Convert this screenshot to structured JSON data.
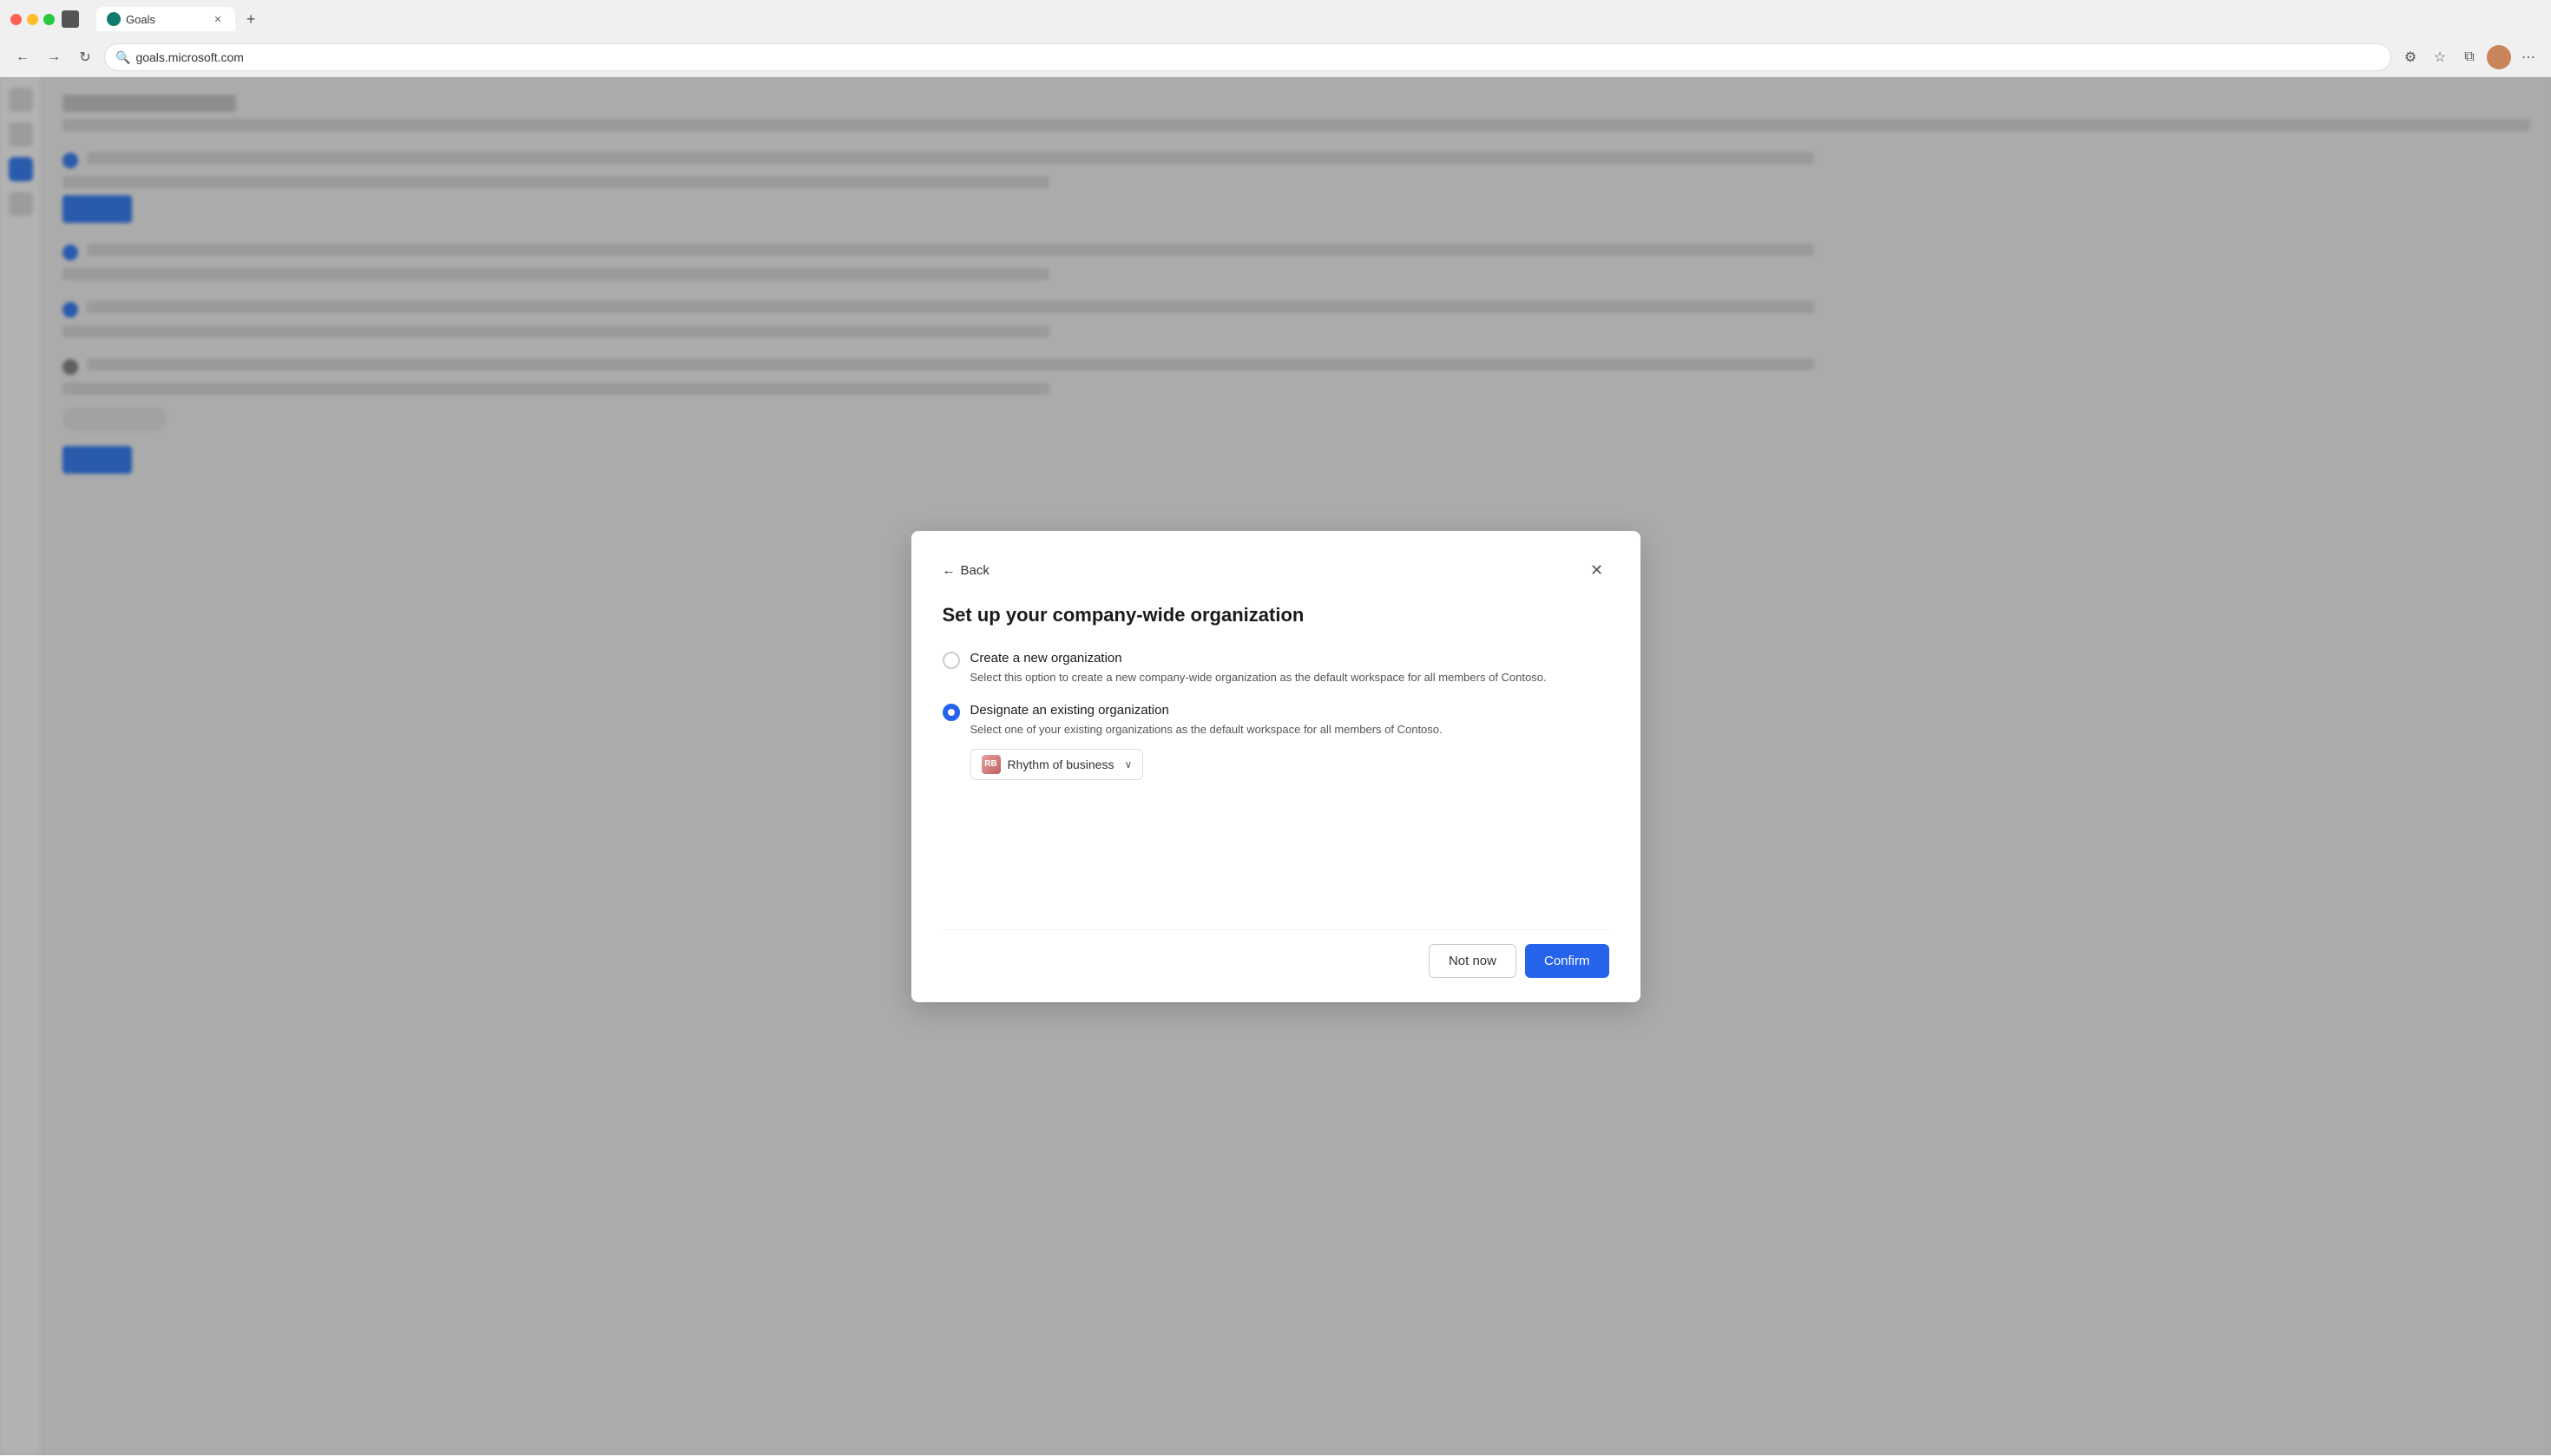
{
  "browser": {
    "tab_title": "Goals",
    "tab_favicon_alt": "Goals favicon",
    "address": "goals.microsoft.com",
    "close_icon": "✕",
    "new_tab_icon": "+",
    "back_icon": "←",
    "forward_icon": "→",
    "refresh_icon": "↻",
    "search_icon": "🔍",
    "star_icon": "☆",
    "extensions_icon": "⧉",
    "profile_icon": "👤",
    "more_icon": "⋯"
  },
  "modal": {
    "back_label": "Back",
    "close_icon": "✕",
    "title": "Set up your company-wide organization",
    "option1": {
      "label": "Create a new organization",
      "description": "Select this option to create a new company-wide organization as the default workspace for all members of Contoso.",
      "selected": false
    },
    "option2": {
      "label": "Designate an existing organization",
      "description": "Select one of your existing organizations as the default workspace for all members of Contoso.",
      "selected": true,
      "dropdown": {
        "avatar_initials": "RB",
        "org_name": "Rhythm of business",
        "chevron": "∨"
      }
    },
    "footer": {
      "not_now_label": "Not now",
      "confirm_label": "Confirm"
    }
  }
}
